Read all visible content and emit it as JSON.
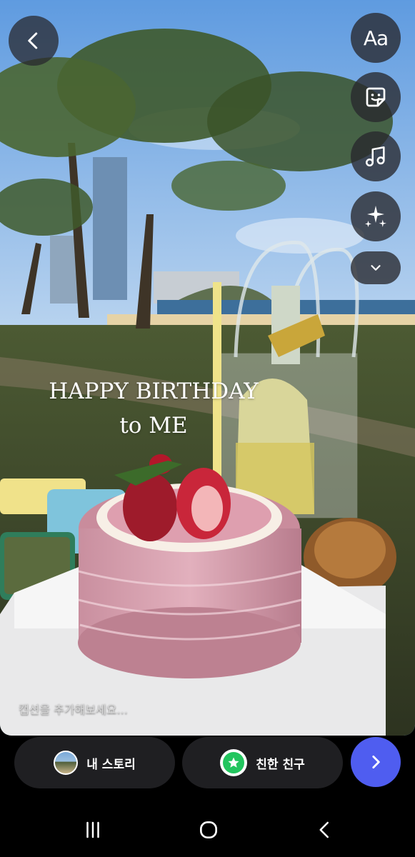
{
  "story": {
    "overlay_line1": "HAPPY BIRTHDAY",
    "overlay_line2": "to ME",
    "caption_placeholder": "캡션을 추가해보세요..."
  },
  "tools": {
    "text_label": "Aa",
    "items": [
      "text-tool",
      "sticker-tool",
      "music-tool",
      "effects-tool",
      "more-tools"
    ]
  },
  "share": {
    "my_story_label": "내 스토리",
    "close_friends_label": "친한 친구"
  },
  "colors": {
    "next_button": "#4f5df0",
    "close_friends_badge": "#22c55e",
    "pill_bg": "#1f1f22"
  }
}
